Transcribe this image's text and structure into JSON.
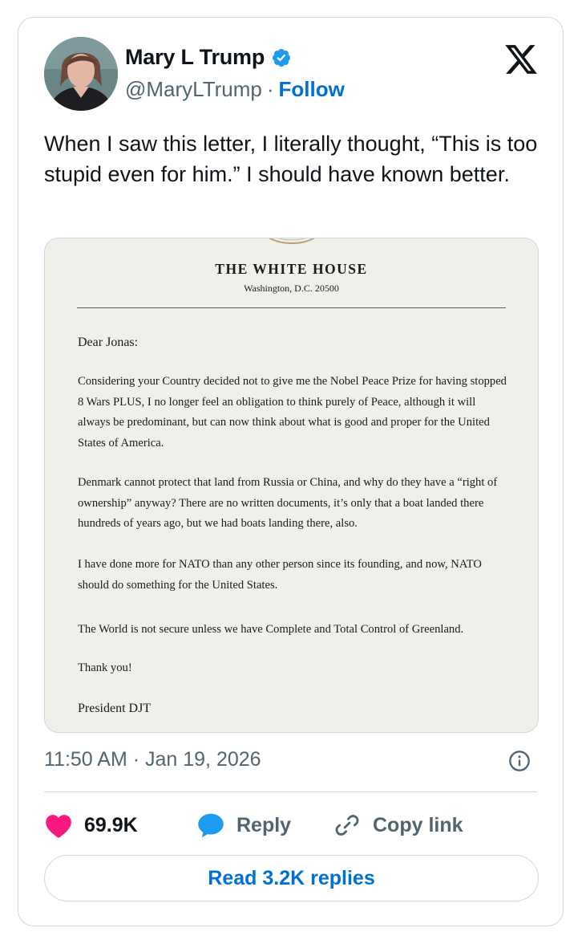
{
  "author": {
    "name": "Mary L Trump",
    "handle": "@MaryLTrump",
    "separator": "·",
    "follow_label": "Follow",
    "verified_color": "#1d9bf0"
  },
  "tweet": {
    "text": "When I saw this letter, I literally thought, “This is too stupid even for him.” I should have known better.",
    "timestamp": "11:50 AM · Jan 19, 2026"
  },
  "letter": {
    "title": "THE WHITE HOUSE",
    "address": "Washington, D.C. 20500",
    "salutation": "Dear Jonas:",
    "paragraphs": [
      "Considering your Country decided not to give me the Nobel Peace Prize for having stopped 8 Wars PLUS, I no longer feel an obligation to think purely of Peace, although it will always be predominant, but can now think about what is good and proper for the United States of America.",
      "Denmark cannot protect that land from Russia or China, and why do they have a “right of ownership” anyway? There are no written documents, it’s only that a boat landed there hundreds of years ago, but we had boats landing there, also.",
      "I have done more for NATO than any other person since its founding, and now, NATO should do something for the United States.",
      "The World is not secure unless we have Complete and Total Control of Greenland."
    ],
    "closing": "Thank you!",
    "signature": "President DJT"
  },
  "actions": {
    "like_count": "69.9K",
    "reply_label": "Reply",
    "copy_link_label": "Copy link",
    "like_color": "#f91880",
    "reply_color": "#1d9bf0"
  },
  "read_replies_label": "Read 3.2K replies",
  "colors": {
    "link_blue": "#006fd6",
    "muted": "#536471",
    "border": "#cfd9de"
  }
}
